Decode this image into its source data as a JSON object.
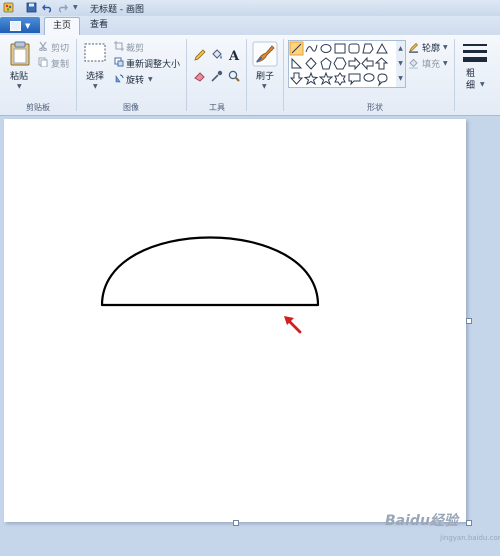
{
  "window": {
    "title": "无标题 - 画图"
  },
  "tabs": {
    "home": "主页",
    "view": "查看"
  },
  "clipboard": {
    "paste": "粘贴",
    "cut": "剪切",
    "copy": "复制",
    "group": "剪贴板"
  },
  "image": {
    "select": "选择",
    "crop": "裁剪",
    "resize": "重新调整大小",
    "rotate": "旋转",
    "group": "图像"
  },
  "tools": {
    "group": "工具"
  },
  "brushes": {
    "label": "刷子"
  },
  "shapes": {
    "outline": "轮廓",
    "fill": "填充",
    "group": "形状"
  },
  "size": {
    "label": "粗细"
  },
  "watermark": {
    "text": "Baidu经验",
    "sub": "jingyan.baidu.com"
  },
  "colors": {
    "accent": "#1e5fb3",
    "canvas": "#ffffff",
    "workspace": "#c5d5ea",
    "arrow": "#d21e1e",
    "highlight": "#ffd37a"
  }
}
